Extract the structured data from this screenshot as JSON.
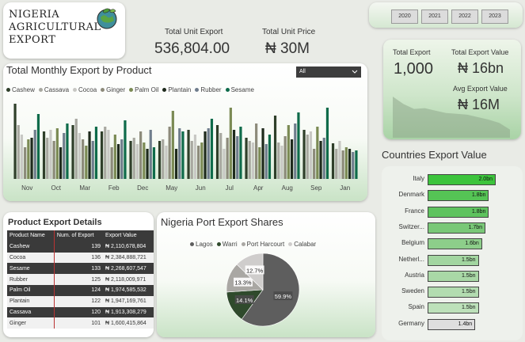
{
  "title": {
    "line1": "NIGERIA",
    "line2": "AGRICULTURAL",
    "line3": "EXPORT"
  },
  "kpis": {
    "total_unit_export_label": "Total Unit Export",
    "total_unit_export_value": "536,804.00",
    "total_unit_price_label": "Total Unit Price",
    "total_unit_price_value": "₦ 30M"
  },
  "years": [
    "2020",
    "2021",
    "2022",
    "2023"
  ],
  "right_kpis": {
    "total_export_label": "Total Export",
    "total_export_value": "1,000",
    "total_export_value_label": "Total Export Value",
    "total_export_value_value": "₦ 16bn",
    "avg_export_value_label": "Avg Export Value",
    "avg_export_value_value": "₦ 16M"
  },
  "monthly": {
    "title": "Total Monthly Export by Product",
    "filter_value": "All",
    "products": [
      {
        "name": "Cashew",
        "color": "#2f3f2a"
      },
      {
        "name": "Cassava",
        "color": "#a8a8a0"
      },
      {
        "name": "Cocoa",
        "color": "#c8c8c4"
      },
      {
        "name": "Ginger",
        "color": "#8c8a7a"
      },
      {
        "name": "Palm Oil",
        "color": "#7b8a54"
      },
      {
        "name": "Plantain",
        "color": "#1e2a1c"
      },
      {
        "name": "Rubber",
        "color": "#6f7d8c"
      },
      {
        "name": "Sesame",
        "color": "#0e6b4a"
      }
    ]
  },
  "chart_data": {
    "type": "bar",
    "categories": [
      "Nov",
      "Oct",
      "Mar",
      "Feb",
      "Dec",
      "May",
      "Jun",
      "Jul",
      "Apr",
      "Aug",
      "Sep",
      "Jan"
    ],
    "series": [
      {
        "name": "Cashew",
        "values": [
          95,
          60,
          68,
          60,
          48,
          48,
          62,
          68,
          52,
          80,
          62,
          45
        ]
      },
      {
        "name": "Cassava",
        "values": [
          68,
          52,
          76,
          66,
          52,
          50,
          48,
          58,
          48,
          46,
          56,
          38
        ]
      },
      {
        "name": "Cocoa",
        "values": [
          56,
          62,
          58,
          62,
          44,
          42,
          56,
          38,
          46,
          42,
          60,
          48
        ]
      },
      {
        "name": "Ginger",
        "values": [
          40,
          48,
          50,
          40,
          60,
          66,
          42,
          52,
          70,
          54,
          38,
          36
        ]
      },
      {
        "name": "Palm Oil",
        "values": [
          50,
          64,
          42,
          56,
          46,
          86,
          46,
          90,
          40,
          68,
          66,
          40
        ]
      },
      {
        "name": "Plantain",
        "values": [
          52,
          40,
          60,
          44,
          38,
          38,
          60,
          62,
          64,
          50,
          48,
          38
        ]
      },
      {
        "name": "Rubber",
        "values": [
          62,
          58,
          48,
          50,
          62,
          64,
          64,
          54,
          44,
          70,
          52,
          34
        ]
      },
      {
        "name": "Sesame",
        "values": [
          82,
          70,
          66,
          74,
          40,
          60,
          76,
          66,
          56,
          84,
          90,
          36
        ]
      }
    ]
  },
  "details": {
    "title": "Product Export Details",
    "headers": [
      "Product Name",
      "Num. of Export",
      "Export Value"
    ],
    "rows": [
      [
        "Cashew",
        "139",
        "₦ 2,110,678,804"
      ],
      [
        "Cocoa",
        "136",
        "₦ 2,384,888,721"
      ],
      [
        "Sesame",
        "133",
        "₦ 2,268,607,547"
      ],
      [
        "Rubber",
        "125",
        "₦ 2,118,009,971"
      ],
      [
        "Palm Oil",
        "124",
        "₦ 1,974,585,532"
      ],
      [
        "Plantain",
        "122",
        "₦ 1,947,169,761"
      ],
      [
        "Cassava",
        "120",
        "₦ 1,913,308,279"
      ],
      [
        "Ginger",
        "101",
        "₦ 1,600,415,864"
      ]
    ]
  },
  "port": {
    "title": "Nigeria Port Export Shares",
    "ports": [
      {
        "name": "Lagos",
        "share": 59.9,
        "label": "59.9%",
        "color": "#5e5e5e"
      },
      {
        "name": "Warri",
        "share": 14.1,
        "label": "14.1%",
        "color": "#2f4a2c"
      },
      {
        "name": "Port Harcourt",
        "share": 13.3,
        "label": "13.3%",
        "color": "#a9a7a3"
      },
      {
        "name": "Calabar",
        "share": 12.7,
        "label": "12.7%",
        "color": "#cfcdcc"
      }
    ]
  },
  "countries": {
    "title": "Countries Export Value",
    "rows": [
      {
        "name": "Italy",
        "value": 2.0,
        "label": "2.0bn",
        "color": "#3cc43c"
      },
      {
        "name": "Denmark",
        "value": 1.8,
        "label": "1.8bn",
        "color": "#55c455"
      },
      {
        "name": "France",
        "value": 1.8,
        "label": "1.8bn",
        "color": "#5ec35e"
      },
      {
        "name": "Switzer...",
        "value": 1.7,
        "label": "1.7bn",
        "color": "#79c877"
      },
      {
        "name": "Belgium",
        "value": 1.6,
        "label": "1.6bn",
        "color": "#8dce8a"
      },
      {
        "name": "Netherl...",
        "value": 1.5,
        "label": "1.5bn",
        "color": "#a2d6a0"
      },
      {
        "name": "Austria",
        "value": 1.5,
        "label": "1.5bn",
        "color": "#a9d8a6"
      },
      {
        "name": "Sweden",
        "value": 1.5,
        "label": "1.5bn",
        "color": "#b2dcb0"
      },
      {
        "name": "Spain",
        "value": 1.5,
        "label": "1.5bn",
        "color": "#bde1ba"
      },
      {
        "name": "Germany",
        "value": 1.4,
        "label": "1.4bn",
        "color": "#dedede"
      }
    ]
  },
  "trend_data": [
    1.0,
    0.82,
    0.7,
    0.72,
    0.66,
    0.6,
    0.58,
    0.56,
    0.5,
    0.44,
    0.36,
    0.2
  ]
}
